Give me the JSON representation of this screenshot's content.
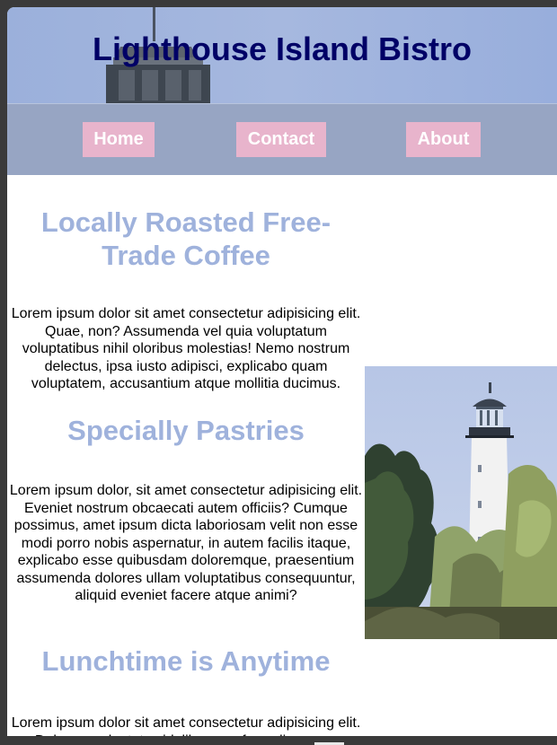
{
  "header": {
    "title": "Lighthouse Island Bistro"
  },
  "nav": {
    "items": [
      {
        "label": "Home"
      },
      {
        "label": "Contact"
      },
      {
        "label": "About"
      }
    ]
  },
  "sections": [
    {
      "heading": "Locally Roasted Free-Trade Coffee",
      "body": "Lorem ipsum dolor sit amet consectetur adipisicing elit. Quae, non? Assumenda vel quia voluptatum voluptatibus nihil oloribus molestias! Nemo nostrum delectus, ipsa iusto adipisci, explicabo quam voluptatem, accusantium atque mollitia ducimus."
    },
    {
      "heading": "Specially Pastries",
      "body": "Lorem ipsum dolor, sit amet consectetur adipisicing elit. Eveniet nostrum obcaecati autem officiis? Cumque possimus, amet ipsum dicta laboriosam velit non esse modi porro nobis aspernatur, in autem facilis itaque, explicabo esse quibusdam doloremque, praesentium assumenda dolores ullam voluptatibus consequuntur, aliquid eveniet facere atque animi?"
    },
    {
      "heading": "Lunchtime is Anytime",
      "body": "Lorem ipsum dolor sit amet consectetur adipisicing elit. Dolorem voluptates id, libero perferendis eaque"
    }
  ],
  "colors": {
    "title": "#000066",
    "nav_background": "#97a5c3",
    "nav_button": "#e8b4cc",
    "section_heading": "#9fb2dc"
  },
  "icons": {
    "header_image": "lighthouse-top-image",
    "photo": "lighthouse-photo"
  }
}
